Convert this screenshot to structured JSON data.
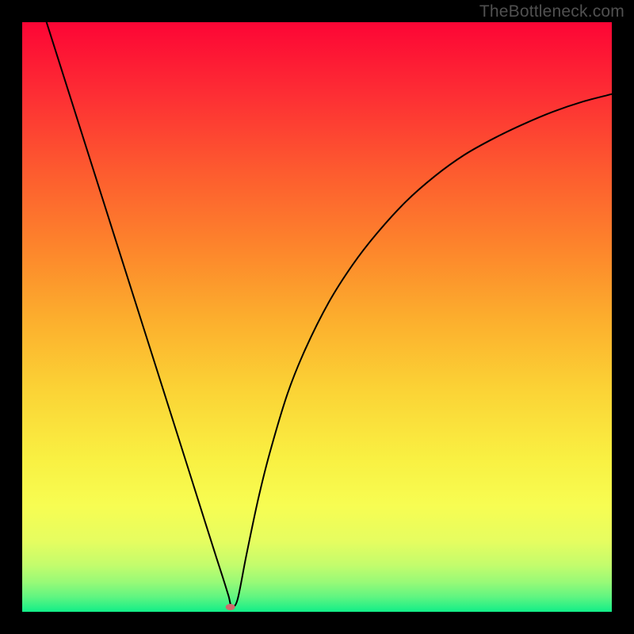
{
  "watermark": "TheBottleneck.com",
  "chart_data": {
    "type": "line",
    "title": "",
    "xlabel": "",
    "ylabel": "",
    "xlim": [
      0,
      100
    ],
    "ylim": [
      0,
      100
    ],
    "grid": false,
    "legend": false,
    "series": [
      {
        "name": "bottleneck-curve",
        "x": [
          0,
          4,
          8,
          12,
          16,
          20,
          24,
          28,
          31,
          33,
          34,
          35,
          35.5,
          36.5,
          38,
          40,
          42,
          45,
          48,
          52,
          56,
          60,
          65,
          70,
          75,
          80,
          85,
          90,
          95,
          100
        ],
        "y": [
          113,
          100.4,
          87.8,
          75.2,
          62.6,
          50,
          37.4,
          24.8,
          15.3,
          9,
          5.9,
          2.7,
          1,
          2,
          9.5,
          19,
          27,
          37,
          44.5,
          52.5,
          58.8,
          64,
          69.5,
          73.9,
          77.5,
          80.3,
          82.7,
          84.8,
          86.5,
          87.8
        ]
      }
    ],
    "marker": {
      "x": 35.3,
      "y": 0.8,
      "color": "#d1696d",
      "rx": 6,
      "ry": 4
    },
    "background_gradient": {
      "type": "vertical",
      "stops": [
        {
          "pos": 0.0,
          "color": "#fd0535"
        },
        {
          "pos": 0.12,
          "color": "#fd2d34"
        },
        {
          "pos": 0.25,
          "color": "#fd5a2f"
        },
        {
          "pos": 0.38,
          "color": "#fd842c"
        },
        {
          "pos": 0.5,
          "color": "#fcad2d"
        },
        {
          "pos": 0.62,
          "color": "#fbd235"
        },
        {
          "pos": 0.74,
          "color": "#f9f042"
        },
        {
          "pos": 0.82,
          "color": "#f7fd52"
        },
        {
          "pos": 0.88,
          "color": "#e6fd60"
        },
        {
          "pos": 0.92,
          "color": "#c4fc6c"
        },
        {
          "pos": 0.95,
          "color": "#97fa77"
        },
        {
          "pos": 0.975,
          "color": "#5ff581"
        },
        {
          "pos": 1.0,
          "color": "#12ee88"
        }
      ]
    }
  }
}
